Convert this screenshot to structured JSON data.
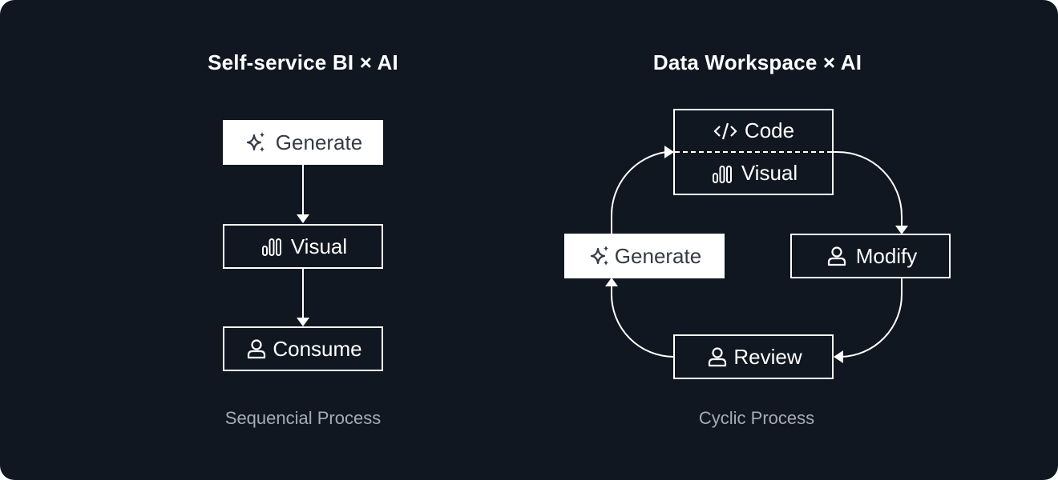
{
  "background_color": "#111720",
  "left_panel": {
    "title": "Self-service BI × AI",
    "caption": "Sequencial Process",
    "nodes": [
      {
        "label": "Generate",
        "icon": "sparkles-icon",
        "style": "filled"
      },
      {
        "label": "Visual",
        "icon": "bar-chart-icon",
        "style": "outline"
      },
      {
        "label": "Consume",
        "icon": "user-icon",
        "style": "outline"
      }
    ],
    "edges": [
      {
        "from": "Generate",
        "to": "Visual"
      },
      {
        "from": "Visual",
        "to": "Consume"
      }
    ]
  },
  "right_panel": {
    "title": "Data Workspace × AI",
    "caption": "Cyclic Process",
    "nodes": {
      "code_visual": {
        "top_label": "Code",
        "top_icon": "code-icon",
        "bottom_label": "Visual",
        "bottom_icon": "bar-chart-icon",
        "style": "outline-split"
      },
      "modify": {
        "label": "Modify",
        "icon": "user-icon",
        "style": "outline"
      },
      "review": {
        "label": "Review",
        "icon": "user-icon",
        "style": "outline"
      },
      "generate": {
        "label": "Generate",
        "icon": "sparkles-icon",
        "style": "filled"
      }
    },
    "edges": [
      {
        "from": "Generate",
        "to": "Code/Visual"
      },
      {
        "from": "Code/Visual",
        "to": "Modify"
      },
      {
        "from": "Modify",
        "to": "Review"
      },
      {
        "from": "Review",
        "to": "Generate"
      }
    ]
  }
}
